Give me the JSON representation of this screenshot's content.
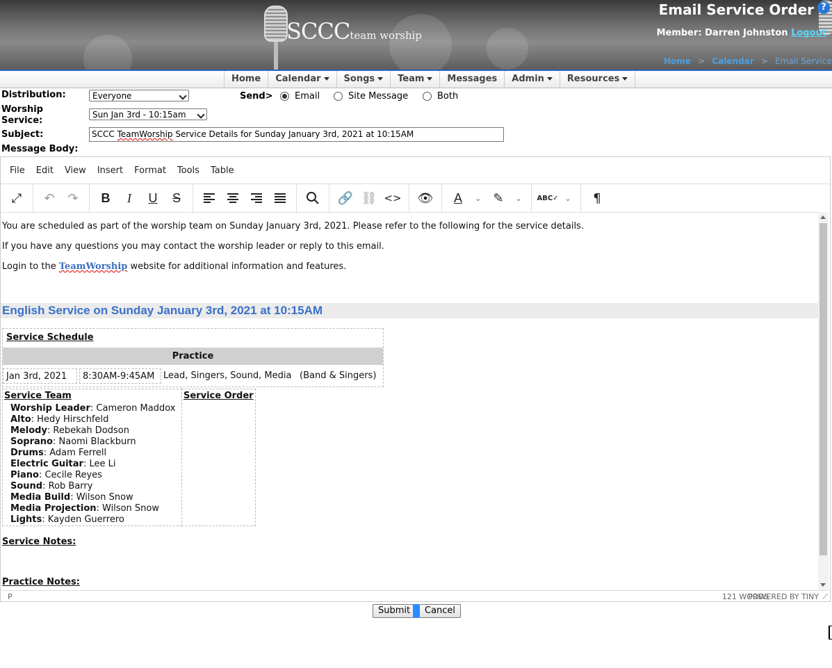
{
  "header": {
    "logo_main": "SCCC",
    "logo_sub": "team worship",
    "page_title": "Email Service Order",
    "help": "?",
    "member_label": "Member: Darren Johnston",
    "logout": "Logout",
    "breadcrumbs": [
      "Home",
      "Calendar",
      "Email Service Order"
    ],
    "breadcrumb_sep": ">"
  },
  "nav": {
    "items": [
      "Home",
      "Calendar",
      "Songs",
      "Team",
      "Messages",
      "Admin",
      "Resources"
    ]
  },
  "form": {
    "distribution_label": "Distribution:",
    "distribution_value": "Everyone",
    "send_label": "Send>",
    "send_options": [
      "Email",
      "Site Message",
      "Both"
    ],
    "send_selected": "Email",
    "worship_label_1": "Worship",
    "worship_label_2": "Service:",
    "worship_value": "Sun Jan 3rd - 10:15am",
    "subject_label": "Subject:",
    "subject_pre": "SCCC ",
    "subject_squiggle": "TeamWorship",
    "subject_post": " Service Details for Sunday January 3rd, 2021 at 10:15AM",
    "body_label": "Message Body:"
  },
  "editor": {
    "menus": [
      "File",
      "Edit",
      "View",
      "Insert",
      "Format",
      "Tools",
      "Table"
    ],
    "toolbar_icons": [
      "fullscreen-icon",
      "undo-icon",
      "redo-icon",
      "bold-icon",
      "italic-icon",
      "underline-icon",
      "strikethrough-icon",
      "align-left-icon",
      "align-center-icon",
      "align-right-icon",
      "justify-icon",
      "search-icon",
      "link-icon",
      "unlink-icon",
      "code-icon",
      "preview-icon",
      "text-color-icon",
      "highlight-icon",
      "spellcheck-icon",
      "show-blocks-icon"
    ],
    "path": "P",
    "word_count": "121 WORDS",
    "powered": "POWERED BY TINY"
  },
  "content": {
    "line1": "You are scheduled as part of the worship team on Sunday January 3rd, 2021. Please refer to the following for the service details.",
    "line2": "If you have any questions you may contact the worship leader or reply to this email.",
    "line3_pre": "Login to the ",
    "line3_link": "TeamWorship",
    "line3_post": " website for additional information and features.",
    "service_heading": "English Service on Sunday January 3rd, 2021 at 10:15AM",
    "schedule_title": "Service Schedule",
    "practice_header": "Practice",
    "practice_date": "Jan 3rd, 2021",
    "practice_time": "8:30AM-9:45AM",
    "practice_who": "Lead, Singers, Sound, Media",
    "practice_note": "(Band & Singers)",
    "team_title": "Service Team",
    "order_title": "Service Order",
    "team": [
      {
        "role": "Worship Leader",
        "name": ": Cameron Maddox"
      },
      {
        "role": "Alto",
        "name": ": Hedy Hirschfeld"
      },
      {
        "role": "Melody",
        "name": ": Rebekah Dodson"
      },
      {
        "role": "Soprano",
        "name": ": Naomi Blackburn"
      },
      {
        "role": "Drums",
        "name": ": Adam Ferrell"
      },
      {
        "role": "Electric Guitar",
        "name": ": Lee Li"
      },
      {
        "role": "Piano",
        "name": ": Cecile Reyes"
      },
      {
        "role": "Sound",
        "name": ": Rob Barry"
      },
      {
        "role": "Media Build",
        "name": ": Wilson Snow"
      },
      {
        "role": "Media Projection",
        "name": ": Wilson Snow"
      },
      {
        "role": "Lights",
        "name": ": Kayden Guerrero"
      }
    ],
    "service_notes": "Service Notes:",
    "practice_notes": "Practice Notes:"
  },
  "buttons": {
    "submit": "Submit",
    "cancel": "Cancel"
  },
  "colors": {
    "accent": "#2a66b8",
    "heading": "#3a70c8",
    "link": "#5ad7ff"
  }
}
